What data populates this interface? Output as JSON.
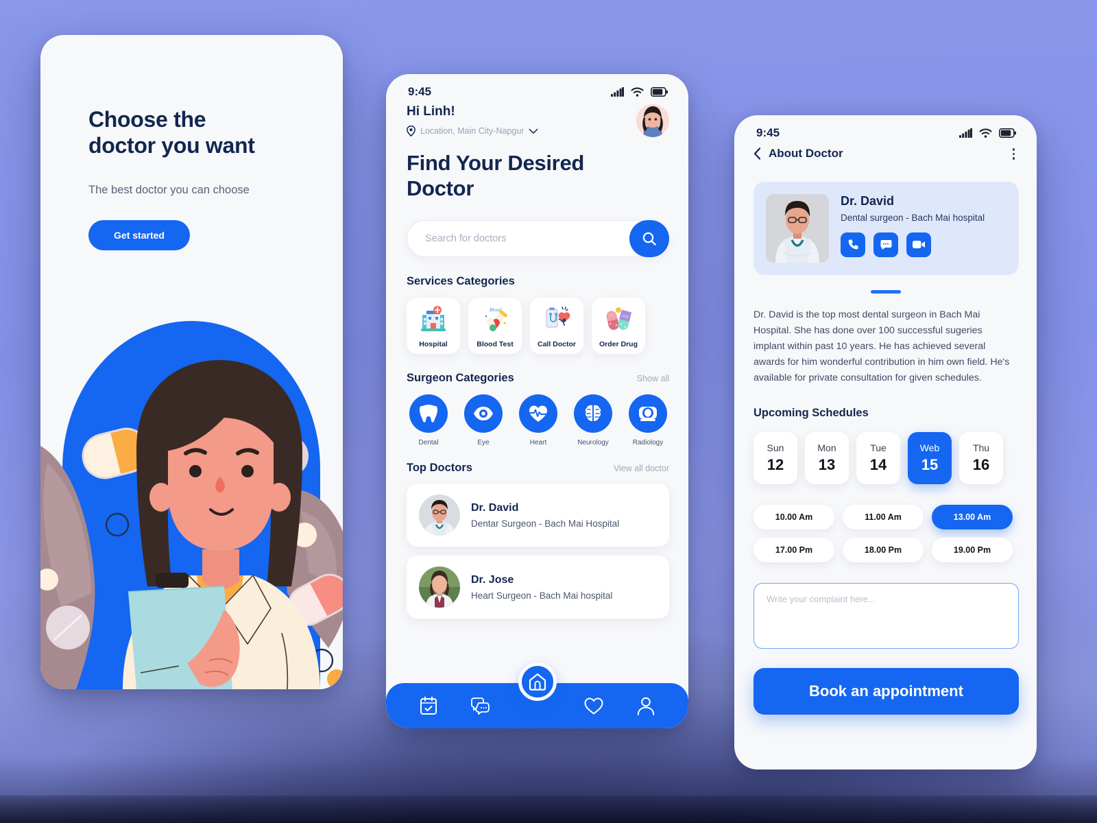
{
  "theme": {
    "accent": "#1566f0",
    "ink": "#12264f",
    "muted": "#9aa1b4",
    "card": "#ffffff",
    "screen_bg": "#f7f8fa",
    "page_bg": "#8190e8"
  },
  "onboarding": {
    "title_line1": "Choose the",
    "title_line2": "doctor you want",
    "subtitle": "The best doctor you can choose",
    "cta_label": "Get started",
    "illustration_name": "female-doctor-with-clipboard-illustration"
  },
  "home": {
    "status": {
      "time": "9:45",
      "signal_icon": "cellular-signal-icon",
      "wifi_icon": "wifi-icon",
      "battery_icon": "battery-icon"
    },
    "greeting": "Hi Linh!",
    "location": "Location, Main City-Napgur",
    "location_icon": "map-pin-icon",
    "location_chevron_icon": "chevron-down-icon",
    "avatar_name": "user-avatar",
    "page_title_line1": "Find Your Desired",
    "page_title_line2": "Doctor",
    "search": {
      "placeholder": "Search for doctors",
      "value": "",
      "button_icon": "search-icon"
    },
    "services": {
      "title": "Services Categories",
      "items": [
        {
          "label": "Hospital",
          "icon": "hospital-building-icon"
        },
        {
          "label": "Blood Test",
          "icon": "blood-test-tube-icon"
        },
        {
          "label": "Call Doctor",
          "icon": "call-doctor-phone-icon"
        },
        {
          "label": "Order Drug",
          "icon": "pill-capsules-icon"
        }
      ]
    },
    "surgeons": {
      "title": "Surgeon Categories",
      "link": "Show all",
      "items": [
        {
          "label": "Dental",
          "icon": "tooth-icon"
        },
        {
          "label": "Eye",
          "icon": "eye-icon"
        },
        {
          "label": "Heart",
          "icon": "heart-pulse-icon"
        },
        {
          "label": "Neurology",
          "icon": "brain-icon"
        },
        {
          "label": "Radiology",
          "icon": "mri-scanner-icon"
        }
      ]
    },
    "top_doctors": {
      "title": "Top Doctors",
      "link": "View all doctor",
      "items": [
        {
          "name": "Dr. David",
          "role": "Dentar Surgeon - Bach Mai Hospital",
          "photo_name": "doctor-david-photo"
        },
        {
          "name": "Dr. Jose",
          "role": "Heart Surgeon - Bach Mai hospital",
          "photo_name": "doctor-jose-photo"
        }
      ]
    },
    "tabbar": {
      "items": [
        {
          "icon": "calendar-check-icon",
          "name": "tab-appointments"
        },
        {
          "icon": "chat-bubbles-icon",
          "name": "tab-messages"
        },
        {
          "icon": "heart-outline-icon",
          "name": "tab-favorites"
        },
        {
          "icon": "person-icon",
          "name": "tab-profile"
        }
      ],
      "home_icon": "home-icon"
    }
  },
  "detail": {
    "status": {
      "time": "9:45",
      "signal_icon": "cellular-signal-icon",
      "wifi_icon": "wifi-icon",
      "battery_icon": "battery-icon"
    },
    "back_icon": "chevron-left-icon",
    "title": "About Doctor",
    "menu_icon": "kebab-menu-icon",
    "doctor": {
      "name": "Dr. David",
      "role": "Dental surgeon - Bach Mai hospital",
      "photo_name": "doctor-david-photo",
      "actions": [
        {
          "name": "call-button",
          "icon": "phone-icon"
        },
        {
          "name": "message-button",
          "icon": "message-icon"
        },
        {
          "name": "video-call-button",
          "icon": "video-camera-icon"
        }
      ]
    },
    "bio": "Dr. David is the top most dental surgeon in Bach Mai Hospital. She has done over 100 successful sugeries implant within past 10 years. He has achieved several awards for him wonderful contribution in him own field. He's available for private consultation for given schedules.",
    "schedules_title": "Upcoming Schedules",
    "days": [
      {
        "name": "Sun",
        "num": "12",
        "selected": false
      },
      {
        "name": "Mon",
        "num": "13",
        "selected": false
      },
      {
        "name": "Tue",
        "num": "14",
        "selected": false
      },
      {
        "name": "Web",
        "num": "15",
        "selected": true
      },
      {
        "name": "Thu",
        "num": "16",
        "selected": false
      }
    ],
    "slots": [
      {
        "label": "10.00 Am",
        "selected": false
      },
      {
        "label": "11.00 Am",
        "selected": false
      },
      {
        "label": "13.00 Am",
        "selected": true
      },
      {
        "label": "17.00 Pm",
        "selected": false
      },
      {
        "label": "18.00 Pm",
        "selected": false
      },
      {
        "label": "19.00 Pm",
        "selected": false
      }
    ],
    "complaint": {
      "placeholder": "Write your complaint here...",
      "value": ""
    },
    "book_label": "Book an appointment"
  }
}
